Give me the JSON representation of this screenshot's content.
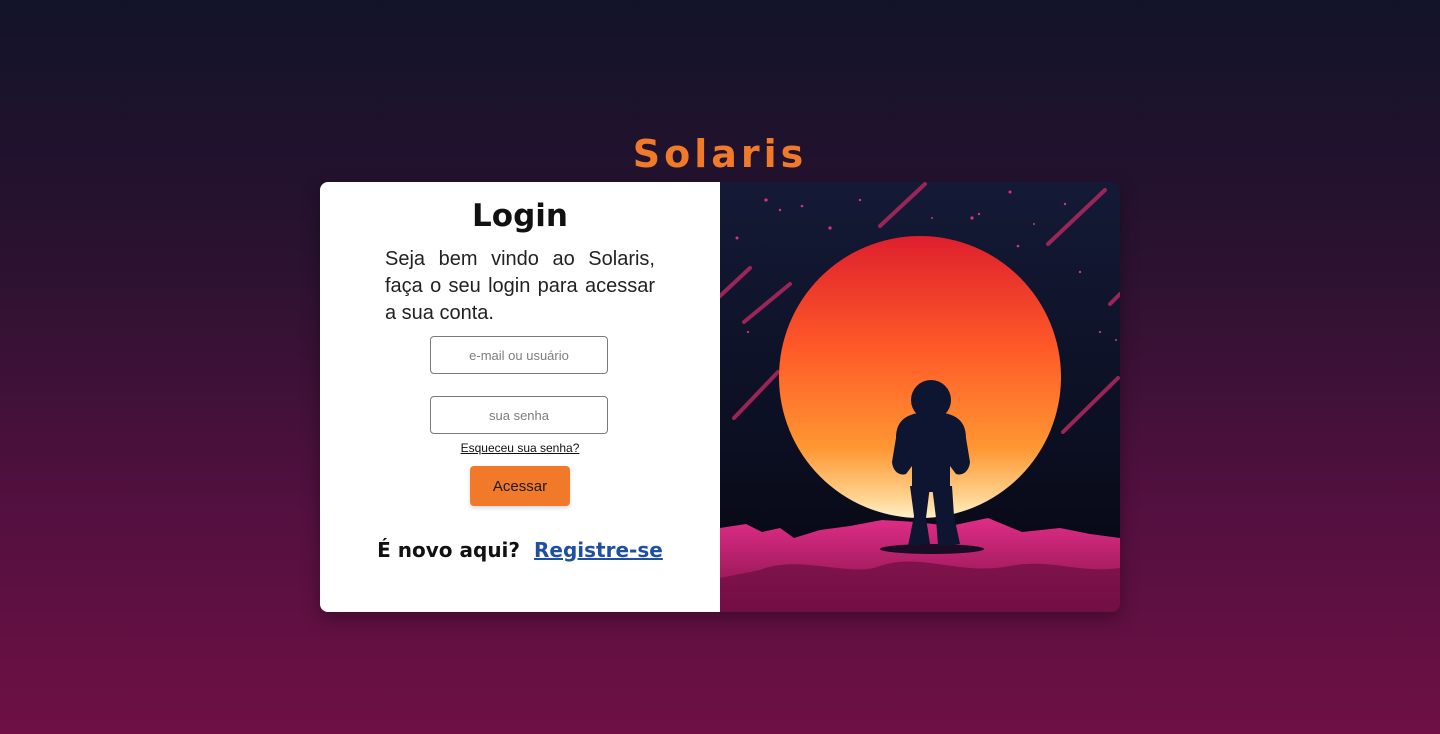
{
  "brand": {
    "name": "Solaris"
  },
  "login": {
    "title": "Login",
    "welcome": "Seja bem vindo ao Solaris, faça o seu login para acessar a sua conta.",
    "email_placeholder": "e-mail ou usuário",
    "password_placeholder": "sua senha",
    "forgot_label": "Esqueceu sua senha?",
    "submit_label": "Acessar",
    "new_here_label": "É novo aqui?",
    "register_label": "Registre-se"
  },
  "illustration": {
    "subject": "astronaut silhouette in front of setting sun",
    "colors": {
      "sky": "#141a36",
      "sun_top": "#e02a2a",
      "sun_bottom": "#ffe6b0",
      "ground": "#e0287a"
    }
  },
  "theme": {
    "accent": "#f07a2a",
    "link": "#1f4fa0"
  }
}
